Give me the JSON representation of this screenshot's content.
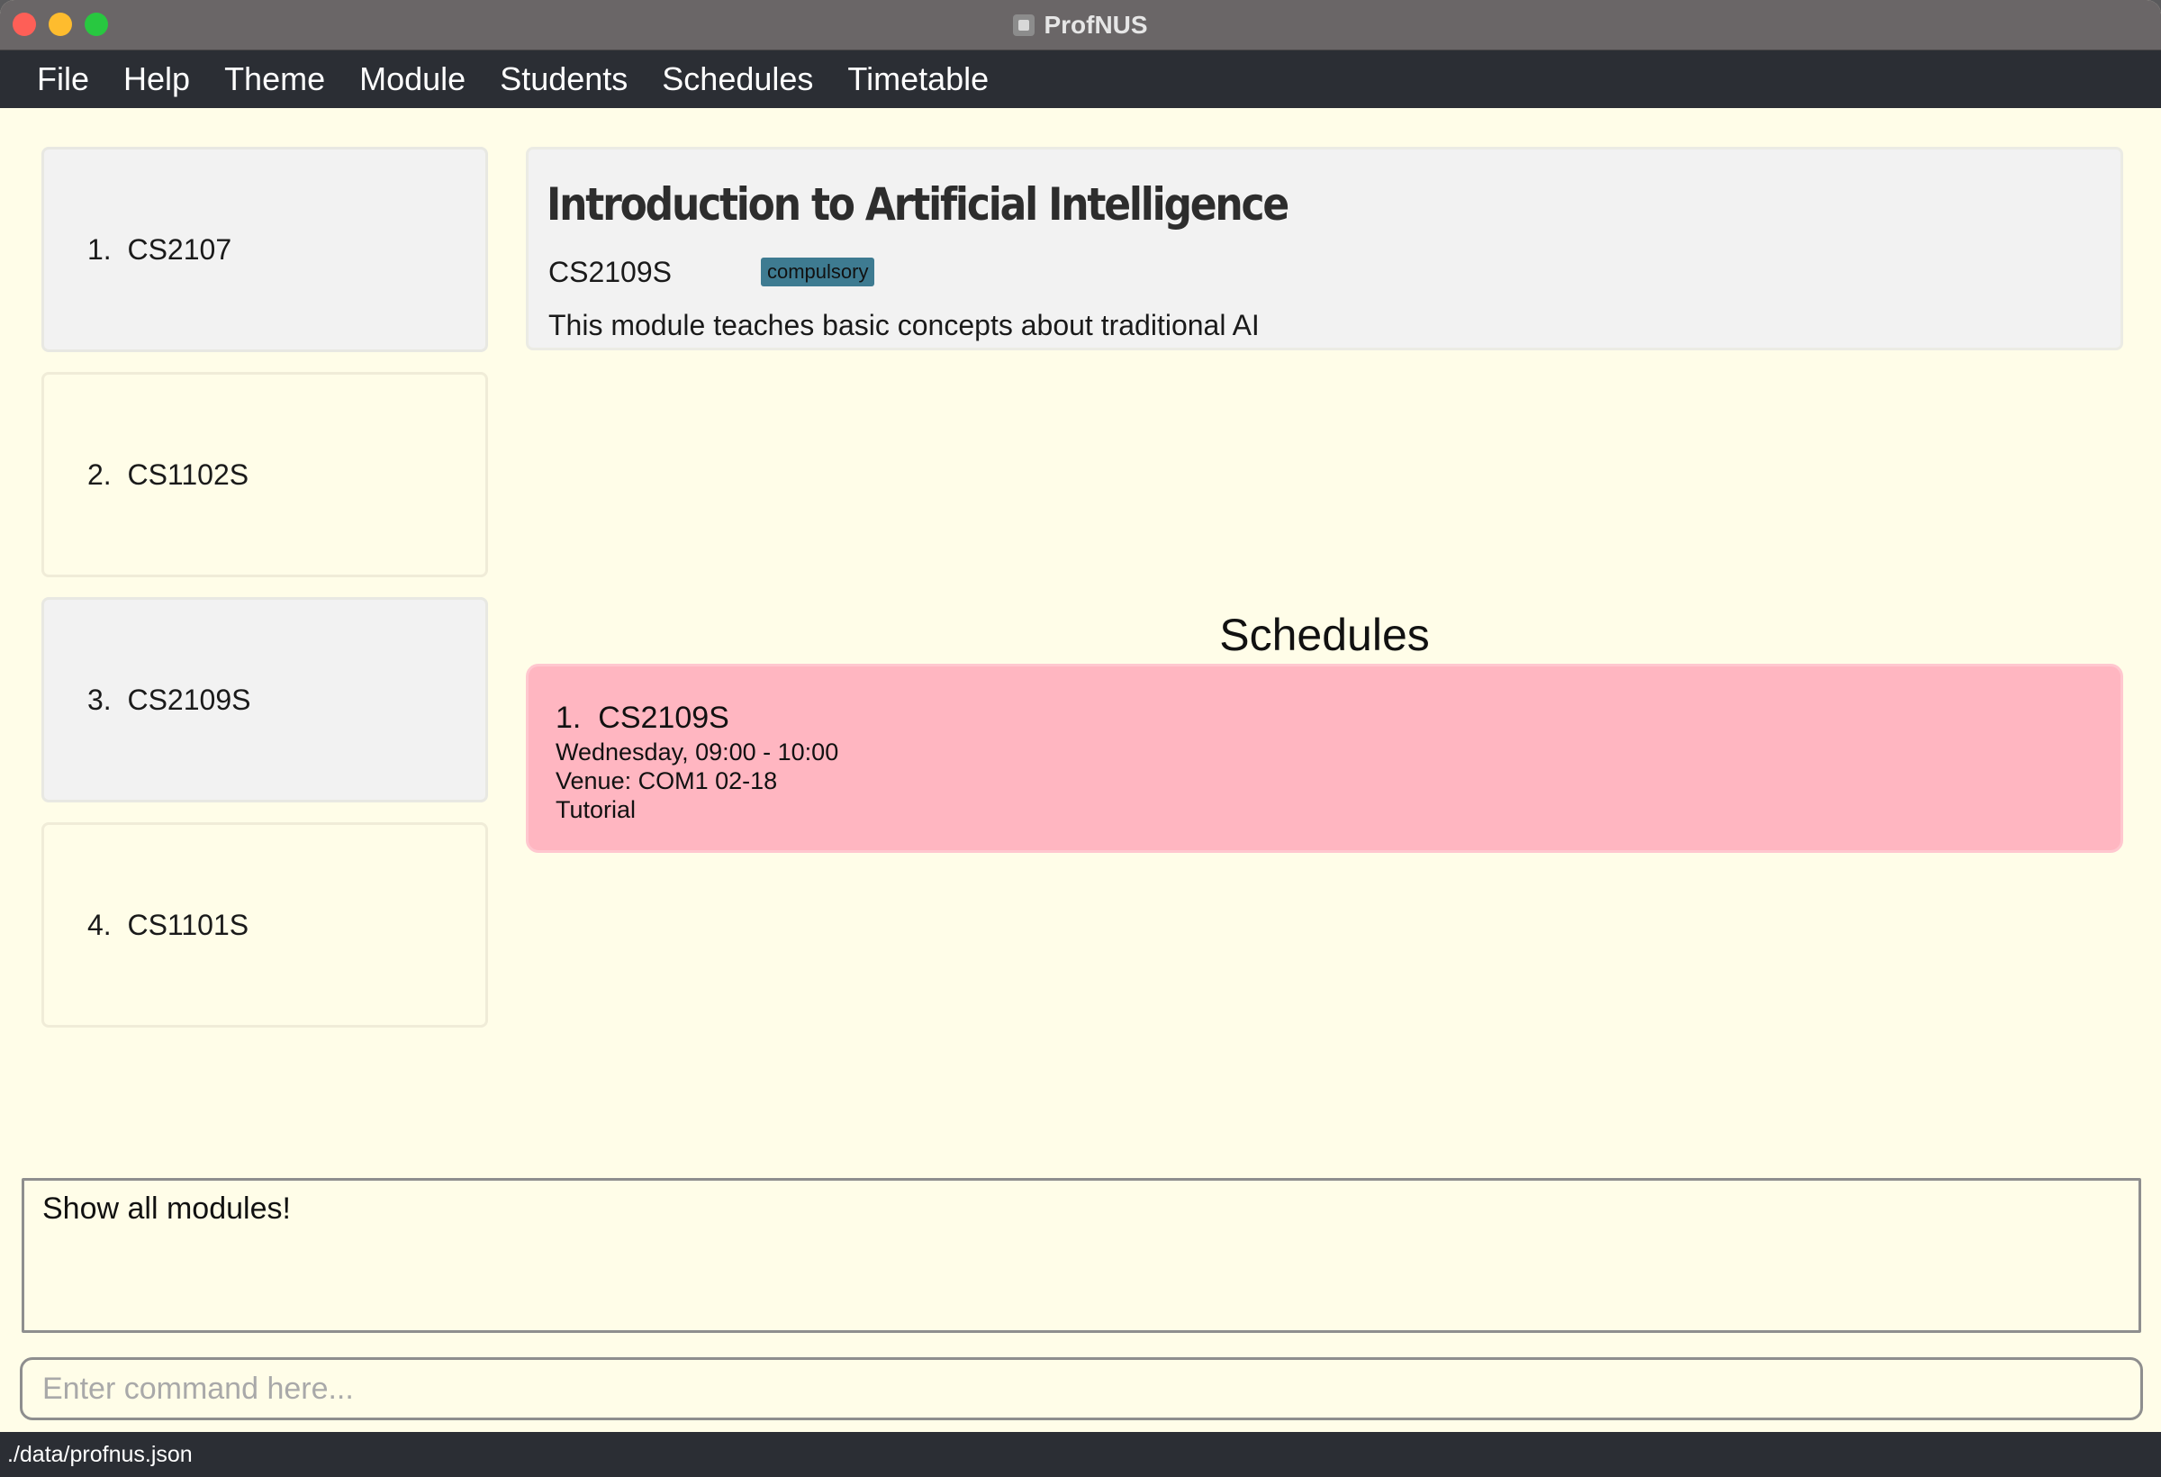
{
  "window": {
    "title": "ProfNUS",
    "app_icon": "person-icon"
  },
  "menu": [
    {
      "label": "File"
    },
    {
      "label": "Help"
    },
    {
      "label": "Theme"
    },
    {
      "label": "Module"
    },
    {
      "label": "Students"
    },
    {
      "label": "Schedules"
    },
    {
      "label": "Timetable"
    }
  ],
  "modules": [
    {
      "index": "1.",
      "code": "CS2107"
    },
    {
      "index": "2.",
      "code": "CS1102S"
    },
    {
      "index": "3.",
      "code": "CS2109S"
    },
    {
      "index": "4.",
      "code": "CS1101S"
    }
  ],
  "detail": {
    "title": "Introduction to Artificial Intelligence",
    "code": "CS2109S",
    "tag": "compulsory",
    "description": "This module teaches basic concepts about traditional AI"
  },
  "schedules": {
    "heading": "Schedules",
    "items": [
      {
        "index": "1.",
        "code": "CS2109S",
        "time": "Wednesday, 09:00 - 10:00",
        "venue": "Venue: COM1 02-18",
        "type": "Tutorial"
      }
    ]
  },
  "result": {
    "text": "Show all modules!"
  },
  "command": {
    "value": "",
    "placeholder": "Enter command here..."
  },
  "status": {
    "path": "./data/profnus.json"
  },
  "colors": {
    "background": "#fffde8",
    "menubar": "#2b2e34",
    "tag": "#3e7b91",
    "schedule_card": "#ffb6c1"
  }
}
